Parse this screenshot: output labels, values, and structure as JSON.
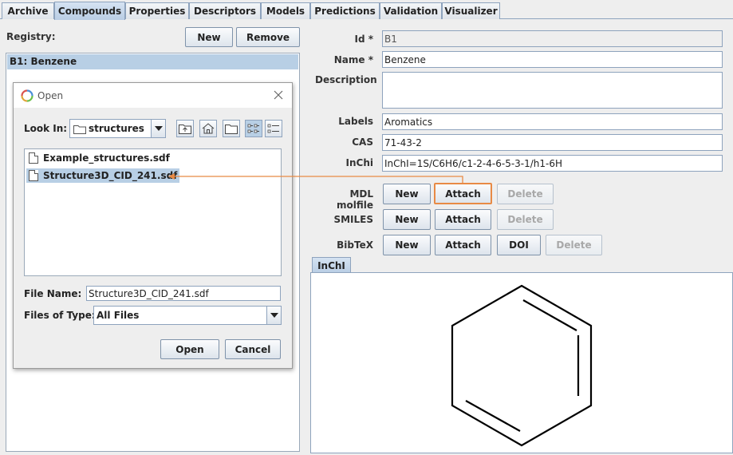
{
  "tabs": [
    {
      "label": "Archive",
      "active": false
    },
    {
      "label": "Compounds",
      "active": true
    },
    {
      "label": "Properties",
      "active": false
    },
    {
      "label": "Descriptors",
      "active": false
    },
    {
      "label": "Models",
      "active": false
    },
    {
      "label": "Predictions",
      "active": false
    },
    {
      "label": "Validation",
      "active": false
    },
    {
      "label": "Visualizer",
      "active": false
    }
  ],
  "registry": {
    "label": "Registry:",
    "new_label": "New",
    "remove_label": "Remove",
    "selected_item": "B1: Benzene"
  },
  "dialog": {
    "title": "Open",
    "look_in_label": "Look In:",
    "look_in_value": "structures",
    "files": [
      "Example_structures.sdf",
      "Structure3D_CID_241.sdf"
    ],
    "selected_file_index": 1,
    "file_name_label": "File Name:",
    "file_name_value": "Structure3D_CID_241.sdf",
    "files_of_type_label": "Files of Type:",
    "files_of_type_value": "All Files",
    "open_label": "Open",
    "cancel_label": "Cancel"
  },
  "form": {
    "id_label": "Id *",
    "id_value": "B1",
    "name_label": "Name *",
    "name_value": "Benzene",
    "description_label": "Description",
    "description_value": "",
    "labels_label": "Labels",
    "labels_value": "Aromatics",
    "cas_label": "CAS",
    "cas_value": "71-43-2",
    "inchi_label": "InChi",
    "inchi_value": "InChI=1S/C6H6/c1-2-4-6-5-3-1/h1-6H",
    "mdl_label": "MDL molfile",
    "smiles_label": "SMILES",
    "bibtex_label": "BibTeX",
    "new_label": "New",
    "attach_label": "Attach",
    "delete_label": "Delete",
    "doi_label": "DOI"
  },
  "structure_tab": "InChI",
  "colors": {
    "accent": "#e88a45",
    "selection": "#b8cfe5",
    "border": "#8ea3bd"
  }
}
